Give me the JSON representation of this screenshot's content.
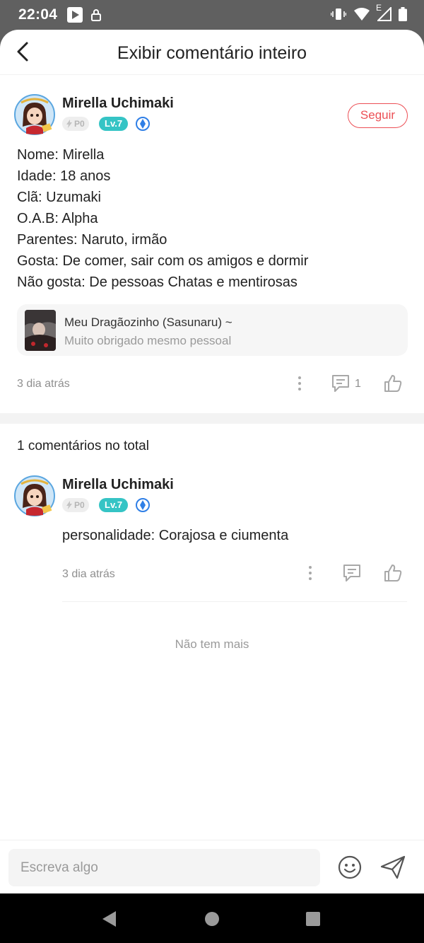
{
  "status_bar": {
    "time": "22:04",
    "icons_left": [
      "play-store-icon",
      "lock-icon"
    ],
    "icons_right": [
      "vibrate-icon",
      "wifi-icon",
      "signal-icon",
      "battery-icon"
    ],
    "network_label": "E"
  },
  "header": {
    "title": "Exibir comentário inteiro",
    "back_icon": "back-arrow-icon"
  },
  "post": {
    "author": "Mirella Uchimaki",
    "badge_points": "P0",
    "badge_level": "Lv.7",
    "follow_label": "Seguir",
    "lines": [
      "Nome: Mirella",
      "Idade: 18 anos",
      "Clã: Uzumaki",
      "O.A.B: Alpha",
      "Parentes: Naruto, irmão",
      "Gosta: De comer, sair com os amigos e dormir",
      "Não gosta: De pessoas Chatas e mentirosas"
    ],
    "link_card": {
      "title": "Meu Dragãozinho (Sasunaru) ~",
      "subtitle": "Muito obrigado mesmo pessoal"
    },
    "time": "3 dia atrás",
    "reply_count": "1"
  },
  "comments": {
    "total_label": "1 comentários no total",
    "items": [
      {
        "author": "Mirella Uchimaki",
        "badge_points": "P0",
        "badge_level": "Lv.7",
        "text": "personalidade: Corajosa e ciumenta",
        "time": "3 dia atrás"
      }
    ],
    "end_label": "Não tem mais"
  },
  "composer": {
    "placeholder": "Escreva algo"
  },
  "colors": {
    "accent_red": "#ec4f55",
    "level_teal": "#35c4c5",
    "gem_blue": "#2f7fe6"
  }
}
